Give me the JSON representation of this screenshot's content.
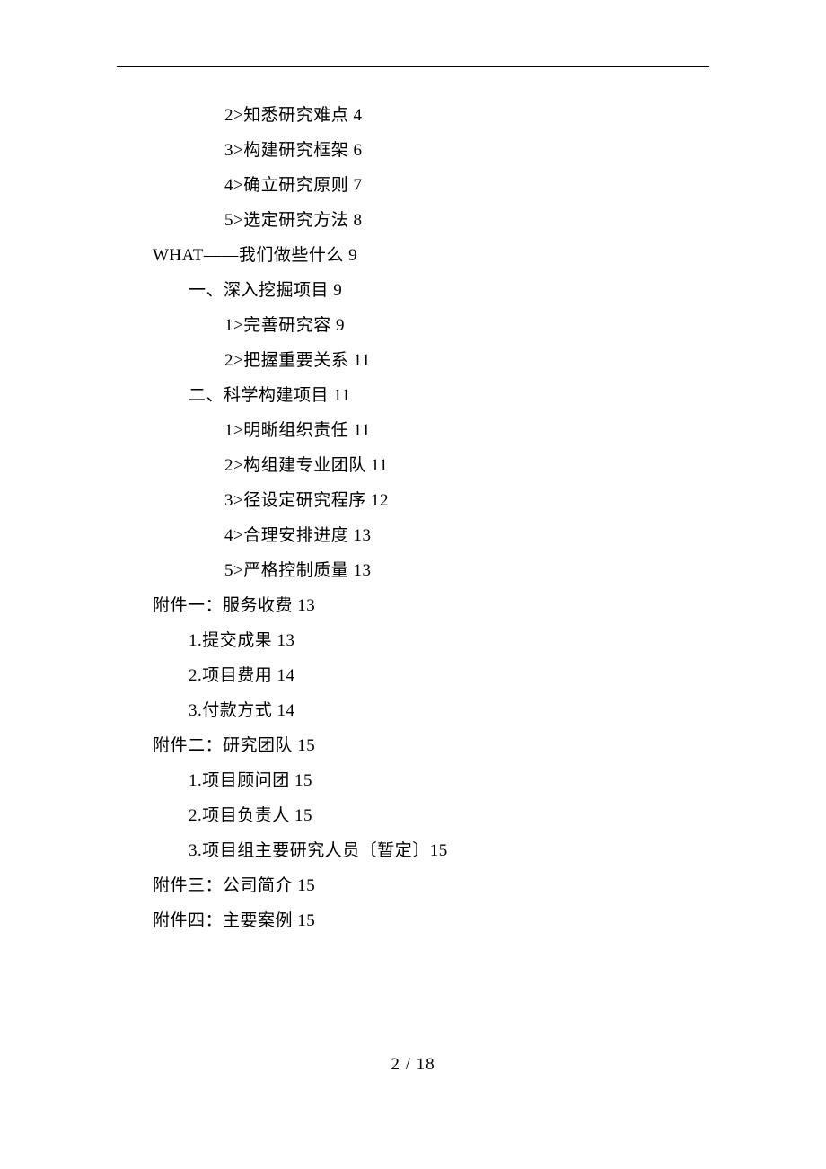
{
  "toc": [
    {
      "indent": 3,
      "text": "2>知悉研究难点 4"
    },
    {
      "indent": 3,
      "text": "3>构建研究框架 6"
    },
    {
      "indent": 3,
      "text": "4>确立研究原则 7"
    },
    {
      "indent": 3,
      "text": "5>选定研究方法 8"
    },
    {
      "indent": 1,
      "text": "WHAT——我们做些什么 9"
    },
    {
      "indent": 2,
      "text": "一、深入挖掘项目 9"
    },
    {
      "indent": 3,
      "text": "1>完善研究容 9"
    },
    {
      "indent": 3,
      "text": "2>把握重要关系 11"
    },
    {
      "indent": 2,
      "text": "二、科学构建项目 11"
    },
    {
      "indent": 3,
      "text": "1>明晰组织责任 11"
    },
    {
      "indent": 3,
      "text": "2>构组建专业团队 11"
    },
    {
      "indent": 3,
      "text": "3>径设定研究程序 12"
    },
    {
      "indent": 3,
      "text": "4>合理安排进度 13"
    },
    {
      "indent": 3,
      "text": "5>严格控制质量 13"
    },
    {
      "indent": 1,
      "text": "附件一：服务收费 13"
    },
    {
      "indent": 2,
      "text": "1.提交成果 13"
    },
    {
      "indent": 2,
      "text": "2.项目费用 14"
    },
    {
      "indent": 2,
      "text": "3.付款方式 14"
    },
    {
      "indent": 1,
      "text": "附件二：研究团队 15"
    },
    {
      "indent": 2,
      "text": "1.项目顾问团 15"
    },
    {
      "indent": 2,
      "text": "2.项目负责人 15"
    },
    {
      "indent": 2,
      "text": "3.项目组主要研究人员〔暂定〕15"
    },
    {
      "indent": 1,
      "text": "附件三：公司简介 15"
    },
    {
      "indent": 1,
      "text": "附件四：主要案例 15"
    }
  ],
  "page_number": "2 / 18"
}
